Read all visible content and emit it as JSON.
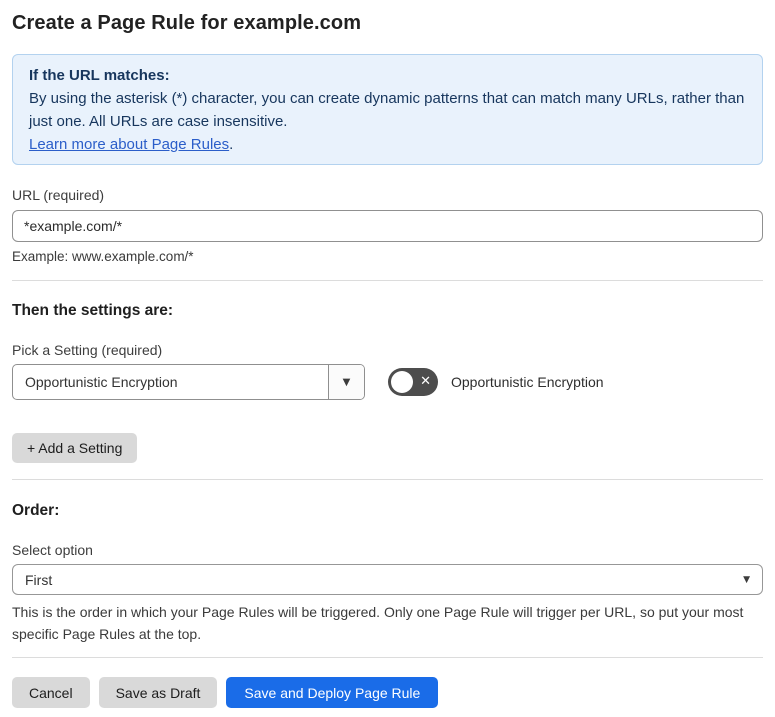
{
  "page": {
    "title": "Create a Page Rule for example.com"
  },
  "info_box": {
    "heading": "If the URL matches:",
    "body": "By using the asterisk (*) character, you can create dynamic patterns that can match many URLs, rather than just one. All URLs are case insensitive.",
    "link_label": "Learn more about Page Rules",
    "link_suffix": "."
  },
  "url_field": {
    "label": "URL (required)",
    "value": "*example.com/*",
    "helper": "Example: www.example.com/*"
  },
  "settings_section": {
    "heading": "Then the settings are:",
    "setting_label": "Pick a Setting (required)",
    "setting_value": "Opportunistic Encryption",
    "toggle_state": "off",
    "toggle_label": "Opportunistic Encryption",
    "add_button_label": "+ Add a Setting"
  },
  "order_section": {
    "heading": "Order:",
    "select_label": "Select option",
    "select_value": "First",
    "helper": "This is the order in which your Page Rules will be triggered. Only one Page Rule will trigger per URL, so put your most specific Page Rules at the top."
  },
  "footer": {
    "cancel_label": "Cancel",
    "save_draft_label": "Save as Draft",
    "save_deploy_label": "Save and Deploy Page Rule"
  },
  "icons": {
    "dropdown_arrow": "▼",
    "toggle_off_x": "✕"
  },
  "colors": {
    "info_box_bg": "#e9f2fc",
    "info_box_border": "#b3d2ef",
    "info_text": "#17365d",
    "link_blue": "#2b5ec9",
    "primary_button_blue": "#1a6ce8",
    "gray_button_bg": "#d9d9d9",
    "toggle_off_bg": "#4d4d4d"
  }
}
